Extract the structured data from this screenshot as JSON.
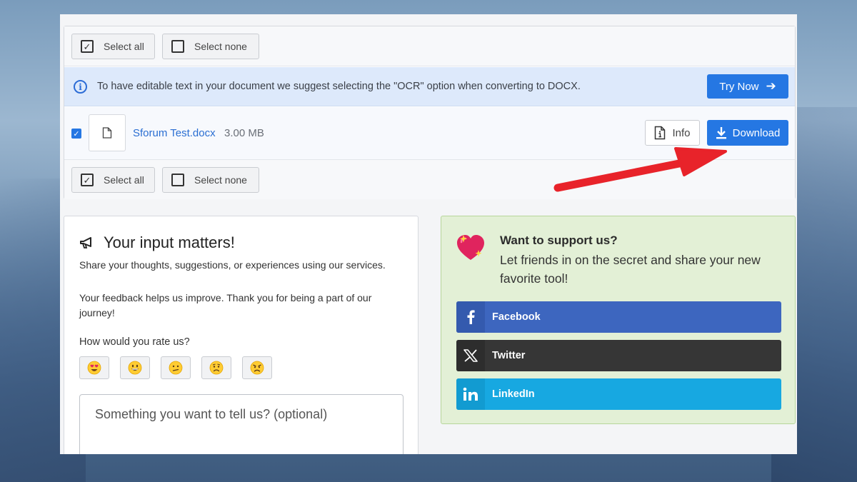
{
  "selection": {
    "select_all": "Select all",
    "select_none": "Select none"
  },
  "notice": {
    "text": "To have editable text in your document we suggest selecting the \"OCR\" option when converting to DOCX.",
    "button": "Try Now"
  },
  "file": {
    "name": "Sforum Test.docx",
    "size": "3.00 MB",
    "checked": true,
    "info_button": "Info",
    "download_button": "Download"
  },
  "feedback": {
    "title": "Your input matters!",
    "paragraph1": "Share your thoughts, suggestions, or experiences using our services.",
    "paragraph2": "Your feedback helps us improve. Thank you for being a part of our journey!",
    "rate_label": "How would you rate us?",
    "ratings": [
      "😍",
      "😃",
      "😕",
      "😟",
      "😠"
    ],
    "textarea_placeholder": "Something you want to tell us? (optional)"
  },
  "support": {
    "title": "Want to support us?",
    "text": "Let friends in on the secret and share your new favorite tool!",
    "buttons": {
      "facebook": "Facebook",
      "twitter": "Twitter",
      "linkedin": "LinkedIn"
    }
  },
  "colors": {
    "primary": "#2577e3",
    "facebook": "#3d66bf",
    "twitter": "#363636",
    "linkedin": "#17a8e1",
    "support_bg": "#e3f0d6",
    "annotation_arrow": "#e8232a"
  }
}
